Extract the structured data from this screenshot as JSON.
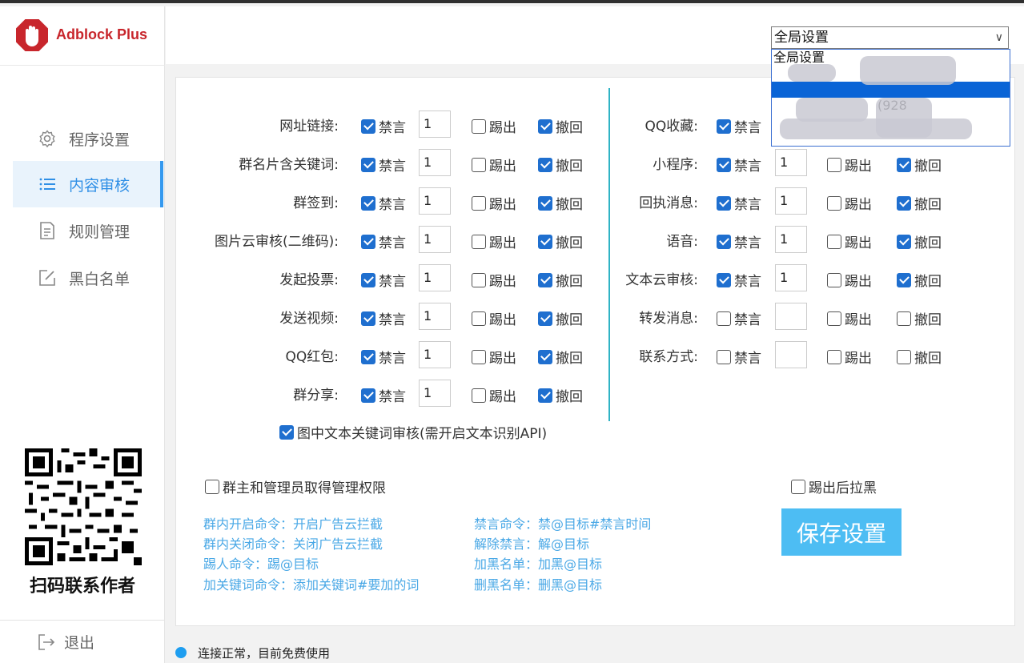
{
  "colors": {
    "accent": "#3599ef",
    "brand_red": "#c8262c",
    "command_text": "#4aa8e6",
    "save_button": "#4dbdf3",
    "divider": "#2fb3c5"
  },
  "app": {
    "name": "Adblock Plus"
  },
  "sidebar": {
    "items": [
      {
        "label": "程序设置",
        "icon": "gear-icon",
        "active": false
      },
      {
        "label": "内容审核",
        "icon": "list-icon",
        "active": true
      },
      {
        "label": "规则管理",
        "icon": "document-icon",
        "active": false
      },
      {
        "label": "黑白名单",
        "icon": "edit-icon",
        "active": false
      }
    ],
    "qr_caption": "扫码联系作者",
    "logout_label": "退出"
  },
  "scope": {
    "selected": "全局设置",
    "options": [
      "全局设置",
      "",
      "",
      "(928",
      "",
      ""
    ]
  },
  "labels": {
    "mute": "禁言",
    "kick": "踢出",
    "recall": "撤回"
  },
  "left_rules": [
    {
      "label": "网址链接:",
      "mute": true,
      "count": "1",
      "kick": false,
      "recall": true
    },
    {
      "label": "群名片含关键词:",
      "mute": true,
      "count": "1",
      "kick": false,
      "recall": true
    },
    {
      "label": "群签到:",
      "mute": true,
      "count": "1",
      "kick": false,
      "recall": true
    },
    {
      "label": "图片云审核(二维码):",
      "mute": true,
      "count": "1",
      "kick": false,
      "recall": true
    },
    {
      "label": "发起投票:",
      "mute": true,
      "count": "1",
      "kick": false,
      "recall": true
    },
    {
      "label": "发送视频:",
      "mute": true,
      "count": "1",
      "kick": false,
      "recall": true
    },
    {
      "label": "QQ红包:",
      "mute": true,
      "count": "1",
      "kick": false,
      "recall": true
    },
    {
      "label": "群分享:",
      "mute": true,
      "count": "1",
      "kick": false,
      "recall": true
    }
  ],
  "right_rules": [
    {
      "label": "QQ收藏:",
      "mute": true,
      "count": "",
      "kick": false,
      "recall": false
    },
    {
      "label": "小程序:",
      "mute": true,
      "count": "1",
      "kick": false,
      "recall": true
    },
    {
      "label": "回执消息:",
      "mute": true,
      "count": "1",
      "kick": false,
      "recall": true
    },
    {
      "label": "语音:",
      "mute": true,
      "count": "1",
      "kick": false,
      "recall": true
    },
    {
      "label": "文本云审核:",
      "mute": true,
      "count": "1",
      "kick": false,
      "recall": true
    },
    {
      "label": "转发消息:",
      "mute": false,
      "count": "",
      "kick": false,
      "recall": false
    },
    {
      "label": "联系方式:",
      "mute": false,
      "count": "",
      "kick": false,
      "recall": false
    }
  ],
  "options": {
    "image_text_audit": {
      "label": "图中文本关键词审核(需开启文本识别API)",
      "checked": true
    },
    "admin_rights": {
      "label": "群主和管理员取得管理权限",
      "checked": false
    },
    "kick_blacklist": {
      "label": "踢出后拉黑",
      "checked": false
    }
  },
  "commands": {
    "left": [
      "群内开启命令：开启广告云拦截",
      "群内关闭命令：关闭广告云拦截",
      "踢人命令：踢@目标",
      "加关键词命令：添加关键词#要加的词"
    ],
    "right": [
      "禁言命令：禁@目标#禁言时间",
      "解除禁言：解@目标",
      "加黑名单：加黑@目标",
      "删黑名单：删黑@目标"
    ]
  },
  "save_label": "保存设置",
  "status": {
    "text": "连接正常，目前免费使用"
  }
}
